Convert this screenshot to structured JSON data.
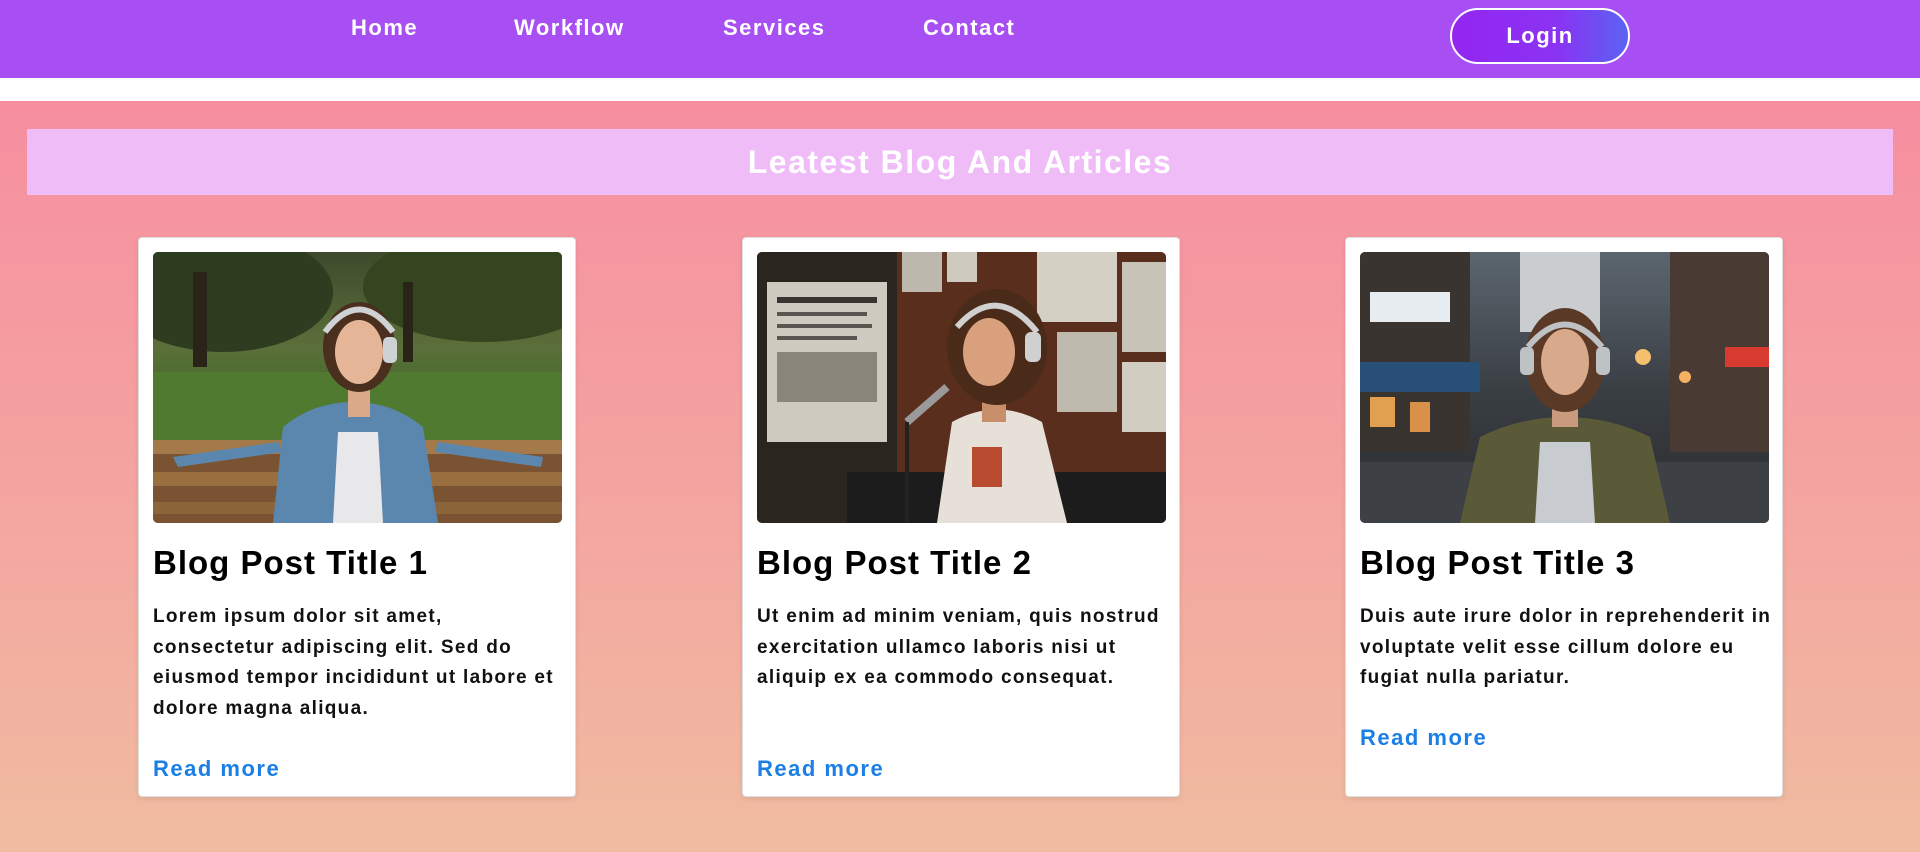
{
  "nav": {
    "links": [
      "Home",
      "Workflow",
      "Services",
      "Contact"
    ],
    "login_label": "Login"
  },
  "blog": {
    "heading": "Leatest Blog And Articles",
    "posts": [
      {
        "title": "Blog Post Title 1",
        "text": "Lorem ipsum dolor sit amet, consectetur adipiscing elit. Sed do eiusmod tempor incididunt ut labore et dolore magna aliqua.",
        "link": "Read more",
        "image": "woman-with-headphones-on-park-bench"
      },
      {
        "title": "Blog Post Title 2",
        "text": "Ut enim ad minim veniam, quis nostrud exercitation ullamco laboris nisi ut aliquip ex ea commodo consequat.",
        "link": "Read more",
        "image": "woman-with-headphones-at-microphone"
      },
      {
        "title": "Blog Post Title 3",
        "text": "Duis aute irure dolor in reprehenderit in voluptate velit esse cillum dolore eu fugiat nulla pariatur.",
        "link": "Read more",
        "image": "woman-with-headphones-on-city-street"
      }
    ]
  },
  "colors": {
    "nav_background": "#a74ff2",
    "banner_background": "#efbcf8",
    "link": "#1b7fe6"
  }
}
